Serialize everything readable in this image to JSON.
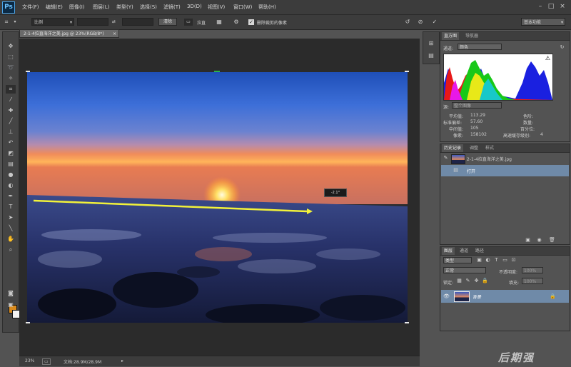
{
  "app": {
    "logo": "Ps"
  },
  "menu": [
    "文件(F)",
    "编辑(E)",
    "图像(I)",
    "图层(L)",
    "类型(Y)",
    "选择(S)",
    "滤镜(T)",
    "3D(D)",
    "视图(V)",
    "窗口(W)",
    "帮助(H)"
  ],
  "window_controls": {
    "minimize": "–",
    "restore": "□",
    "close": "×"
  },
  "options": {
    "ratio_select": "比例",
    "swap_icon": "⇄",
    "clear_button": "清除",
    "straighten_label": "拉直",
    "delete_cropped_label": "删除裁剪的像素",
    "workspace_select": "基本功能"
  },
  "document": {
    "tab_title": "2-1-4拉直海洋之美.jpg @ 23%(RGB/8*)",
    "angle_readout": "-2.1°",
    "zoom": "23%",
    "doc_size": "文档:28.9M/28.9M"
  },
  "histogram_panel": {
    "tabs": [
      "直方图",
      "导航器"
    ],
    "channel_label": "通道:",
    "channel_value": "颜色",
    "source_label": "源:",
    "source_value": "整个图像",
    "stats_left": [
      {
        "label": "平均值:",
        "value": "113.29"
      },
      {
        "label": "标准偏差:",
        "value": "57.60"
      },
      {
        "label": "中间值:",
        "value": "105"
      },
      {
        "label": "像素:",
        "value": "158102"
      }
    ],
    "stats_right": [
      {
        "label": "色阶:",
        "value": ""
      },
      {
        "label": "数量:",
        "value": ""
      },
      {
        "label": "百分位:",
        "value": ""
      },
      {
        "label": "高速缓存级别:",
        "value": "4"
      }
    ]
  },
  "history_panel": {
    "tabs": [
      "历史记录",
      "调整",
      "样式"
    ],
    "snapshot": "2-1-4拉直海洋之美.jpg",
    "items": [
      "打开"
    ]
  },
  "layers_panel": {
    "tabs": [
      "图层",
      "通道",
      "路径"
    ],
    "filter_label": "类型",
    "blend_mode": "正常",
    "opacity_label": "不透明度:",
    "opacity_value": "100%",
    "lock_label": "锁定:",
    "fill_label": "填充:",
    "fill_value": "100%",
    "layer_name": "背景"
  },
  "watermark": "后期强",
  "colors": {
    "foreground": "#d98a1c",
    "background": "#f2f2f2",
    "straighten_line": "#f2f23a",
    "selection_blue": "#6f8aa8"
  }
}
